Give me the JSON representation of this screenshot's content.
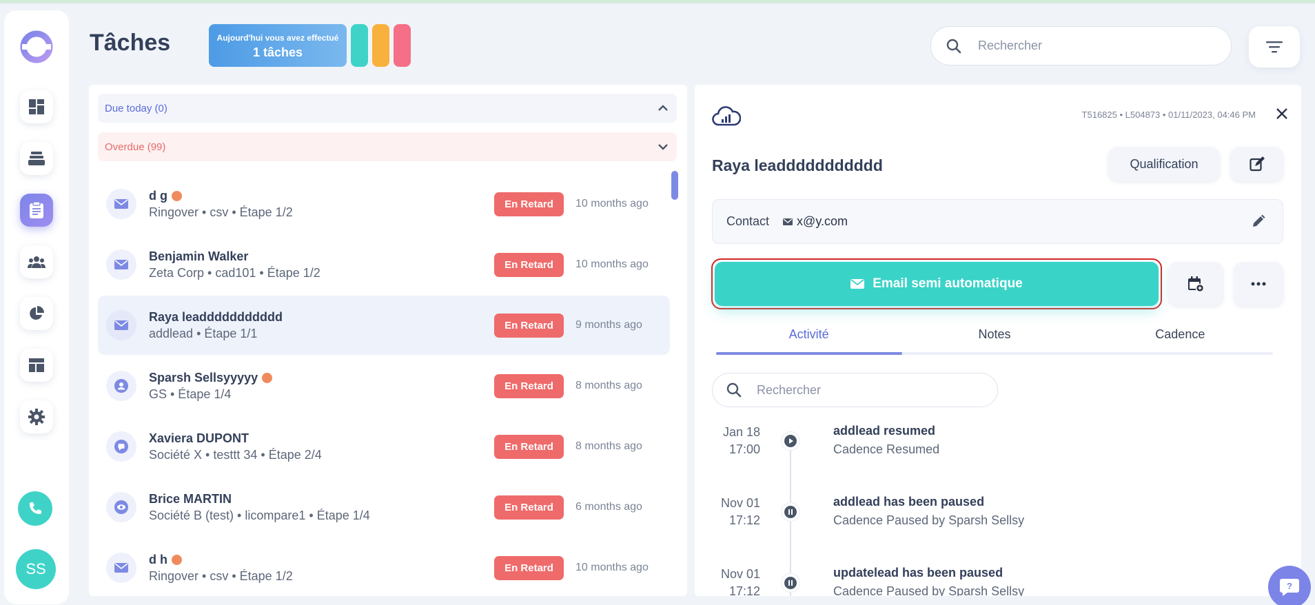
{
  "sidebar": {
    "nav_items": [
      "dashboard",
      "inbox",
      "tasks",
      "contacts",
      "reports",
      "templates",
      "settings"
    ],
    "avatar_initials": "SS"
  },
  "header": {
    "title": "Tâches",
    "today_line1": "Aujourd'hui vous avez effectué",
    "today_line2": "1 tâches",
    "search_placeholder": "Rechercher"
  },
  "colors": {
    "accent": "#7c84e8",
    "teal": "#3ad3c8",
    "overdue": "#ef6a6a",
    "pill_colors": [
      "#3fd3c8",
      "#f7b13c",
      "#f56f87"
    ]
  },
  "groups": {
    "due": "Due today (0)",
    "overdue": "Overdue (99)"
  },
  "tasks": [
    {
      "name": "d g",
      "sub": "Ringover • csv • Étape 1/2",
      "status": "En Retard",
      "time": "10 months ago",
      "icon": "mail-icon",
      "flag": true
    },
    {
      "name": "Benjamin Walker",
      "sub": "Zeta Corp • cad101 • Étape 1/2",
      "status": "En Retard",
      "time": "10 months ago",
      "icon": "mail-icon",
      "flag": false
    },
    {
      "name": "Raya leaddddddddddd",
      "sub": "addlead • Étape 1/1",
      "status": "En Retard",
      "time": "9 months ago",
      "icon": "mail-icon",
      "flag": false
    },
    {
      "name": "Sparsh Sellsyyyyy",
      "sub": "GS • Étape 1/4",
      "status": "En Retard",
      "time": "8 months ago",
      "icon": "person-icon",
      "flag": true
    },
    {
      "name": "Xaviera DUPONT",
      "sub": "Société X • testtt 34 • Étape 2/4",
      "status": "En Retard",
      "time": "8 months ago",
      "icon": "chat-icon",
      "flag": false
    },
    {
      "name": "Brice MARTIN",
      "sub": "Société B (test) • licompare1 • Étape 1/4",
      "status": "En Retard",
      "time": "6 months ago",
      "icon": "eye-icon",
      "flag": false
    },
    {
      "name": "d h",
      "sub": "Ringover • csv • Étape 1/2",
      "status": "En Retard",
      "time": "10 months ago",
      "icon": "mail-icon",
      "flag": true
    }
  ],
  "detail": {
    "meta": "T516825 • L504873 • 01/11/2023, 04:46 PM",
    "lead_name": "Raya leaddddddddddd",
    "qualification_label": "Qualification",
    "contact_label": "Contact",
    "contact_email": "x@y.com",
    "email_button": "Email semi automatique",
    "tabs": [
      "Activité",
      "Notes",
      "Cadence"
    ],
    "activity_search_placeholder": "Rechercher",
    "activities": [
      {
        "date": "Jan 18",
        "time": "17:00",
        "title": "addlead resumed",
        "desc": "Cadence Resumed",
        "icon": "play-icon"
      },
      {
        "date": "Nov 01",
        "time": "17:12",
        "title": "addlead has been paused",
        "desc": "Cadence Paused by Sparsh Sellsy",
        "icon": "pause-icon"
      },
      {
        "date": "Nov 01",
        "time": "17:12",
        "title": "updatelead has been paused",
        "desc": "Cadence Paused by Sparsh Sellsy",
        "icon": "pause-icon"
      }
    ]
  }
}
